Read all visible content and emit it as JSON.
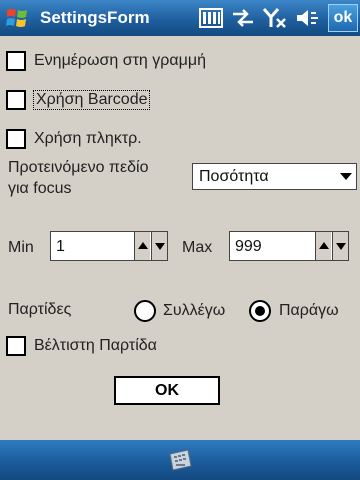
{
  "window": {
    "title": "SettingsForm"
  },
  "tray": {
    "ok_label": "ok",
    "icons": [
      "battery-icon",
      "connectivity-icon",
      "signal-off-icon",
      "volume-muted-icon"
    ]
  },
  "form": {
    "online_update_label": "Ενημέρωση στη γραμμή",
    "use_barcode_label": "Χρήση Barcode",
    "use_keypad_label": "Χρήση πληκτρ.",
    "focus_field_label_line1": "Προτεινόμενο πεδίο",
    "focus_field_label_line2": "για focus",
    "focus_field_value": "Ποσότητα",
    "min_label": "Min",
    "min_value": "1",
    "max_label": "Max",
    "max_value": "999",
    "batches_label": "Παρτίδες",
    "radio_collect_label": "Συλλέγω",
    "radio_produce_label": "Παράγω",
    "radio_selected": "Παράγω",
    "best_batch_label": "Βέλτιστη Παρτίδα",
    "ok_button_label": "OK"
  },
  "colors": {
    "titlebar": "#1f5f9f",
    "form_bg": "#d4d0c8"
  }
}
